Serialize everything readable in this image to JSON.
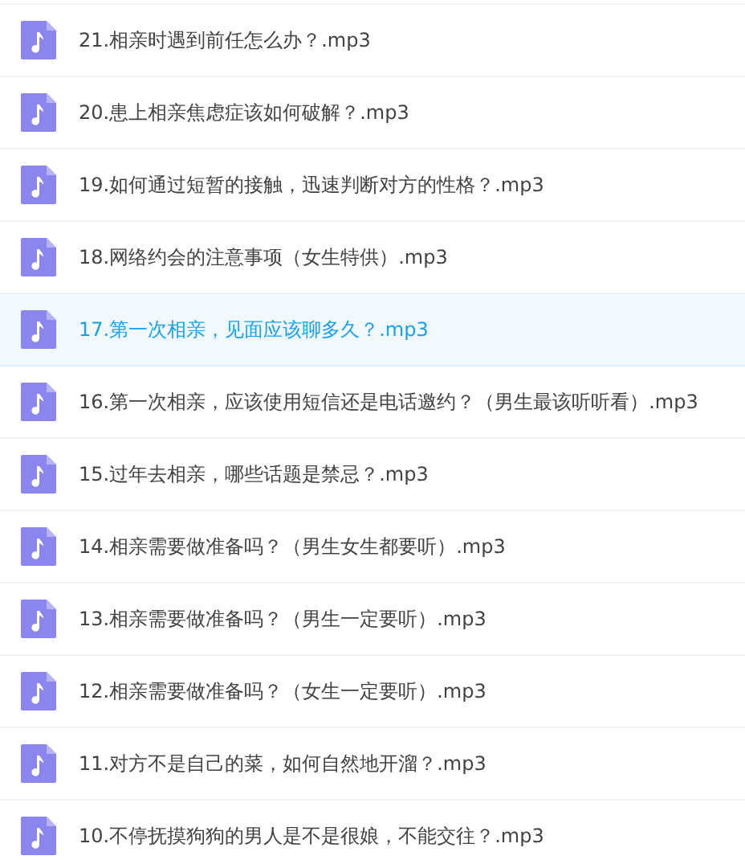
{
  "files": [
    {
      "name": "21.相亲时遇到前任怎么办？.mp3",
      "selected": false
    },
    {
      "name": "20.患上相亲焦虑症该如何破解？.mp3",
      "selected": false
    },
    {
      "name": "19.如何通过短暂的接触，迅速判断对方的性格？.mp3",
      "selected": false
    },
    {
      "name": "18.网络约会的注意事项（女生特供）.mp3",
      "selected": false
    },
    {
      "name": "17.第一次相亲，见面应该聊多久？.mp3",
      "selected": true
    },
    {
      "name": "16.第一次相亲，应该使用短信还是电话邀约？（男生最该听听看）.mp3",
      "selected": false
    },
    {
      "name": "15.过年去相亲，哪些话题是禁忌？.mp3",
      "selected": false
    },
    {
      "name": "14.相亲需要做准备吗？（男生女生都要听）.mp3",
      "selected": false
    },
    {
      "name": "13.相亲需要做准备吗？（男生一定要听）.mp3",
      "selected": false
    },
    {
      "name": "12.相亲需要做准备吗？（女生一定要听）.mp3",
      "selected": false
    },
    {
      "name": "11.对方不是自己的菜，如何自然地开溜？.mp3",
      "selected": false
    },
    {
      "name": "10.不停抚摸狗狗的男人是不是很娘，不能交往？.mp3",
      "selected": false
    }
  ]
}
